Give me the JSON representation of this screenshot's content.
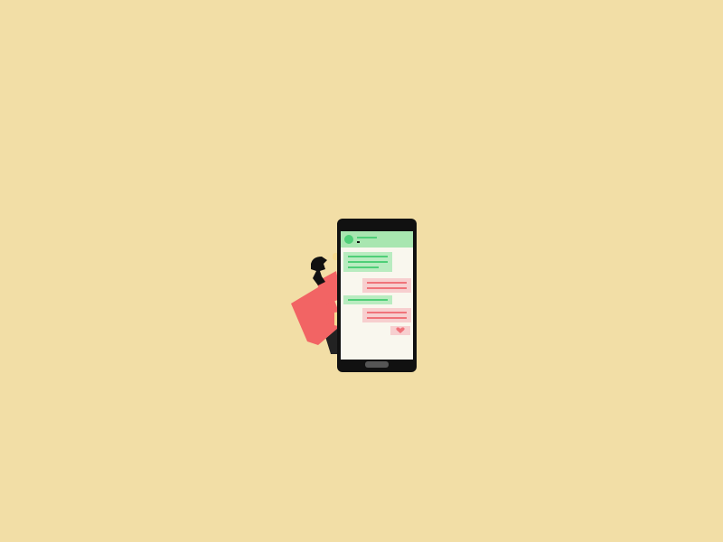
{
  "scene": {
    "description_colors": {
      "background": "#f2dea6",
      "phone_body": "#111111",
      "screen": "#f9f7ee",
      "header_green": "#a8e6b0",
      "incoming_bubble": "#b9ecc0",
      "incoming_line": "#4fcf78",
      "outgoing_bubble": "#f7cfcf",
      "outgoing_line": "#f0737a",
      "sleeve_red": "#f26464",
      "skin": "#f6d98f",
      "hair": "#111111"
    },
    "icons": {
      "heart": "heart-icon",
      "avatar": "avatar-icon"
    }
  }
}
